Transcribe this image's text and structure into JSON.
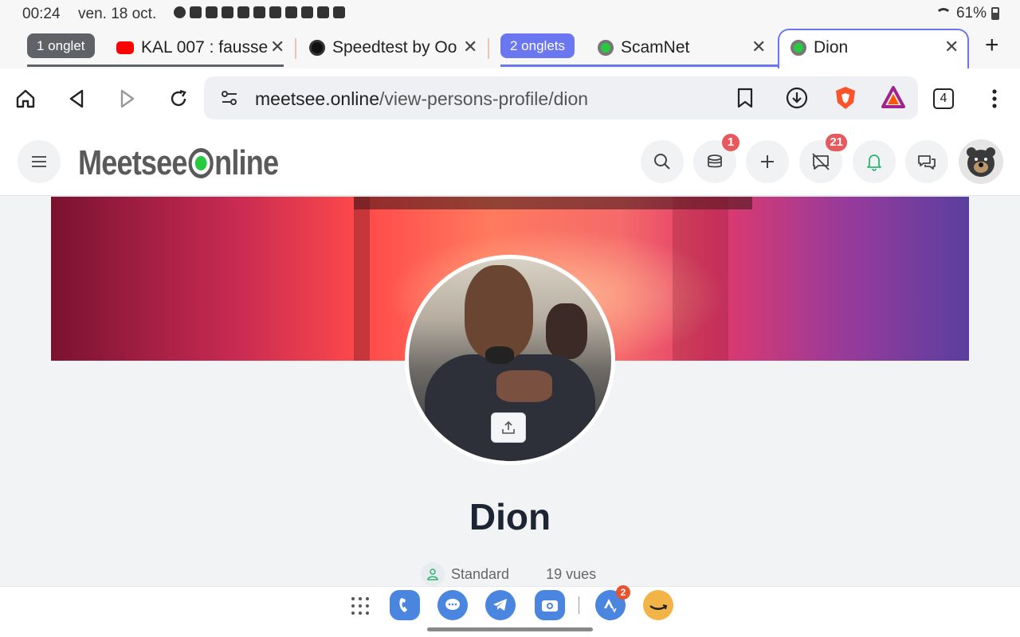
{
  "status_bar": {
    "time": "00:24",
    "date": "ven. 18 oct.",
    "battery": "61%"
  },
  "tabs": {
    "group1_label": "1 onglet",
    "group2_label": "2 onglets",
    "items": [
      {
        "title": "KAL 007 : fausse",
        "icon": "youtube-icon"
      },
      {
        "title": "Speedtest by Ookla",
        "icon": "speedtest-icon"
      },
      {
        "title": "ScamNet",
        "icon": "meetsee-icon"
      },
      {
        "title": "Dion",
        "icon": "meetsee-icon"
      }
    ],
    "close_glyph": "✕",
    "new_tab_glyph": "+"
  },
  "toolbar": {
    "url_host": "meetsee.online",
    "url_path": "/view-persons-profile/dion",
    "tab_count": "4"
  },
  "site": {
    "logo_left": "Meetsee",
    "logo_right": "nline",
    "wallet_badge": "1",
    "notifications_badge": "21"
  },
  "profile": {
    "name": "Dion",
    "membership": "Standard",
    "views": "19 vues"
  },
  "dock": {
    "notification_badge": "2"
  },
  "colors": {
    "group2_chip": "#6a77f0",
    "group1_chip": "#5f6368",
    "badge_red": "#e8595d",
    "brand_green": "#27c93f"
  }
}
